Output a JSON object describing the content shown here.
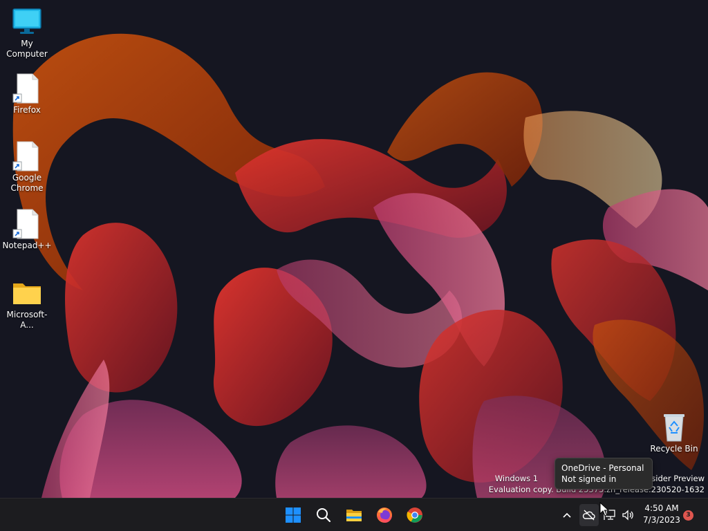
{
  "desktop": {
    "icons": [
      {
        "label": "My Computer"
      },
      {
        "label": "Firefox"
      },
      {
        "label": "Google Chrome"
      },
      {
        "label": "Notepad++"
      },
      {
        "label": "Microsoft-A..."
      },
      {
        "label": "Recycle Bin"
      }
    ],
    "watermark": {
      "line1": "Windows 1                                       n Insider Preview",
      "line2": "Evaluation copy. Build 25375.zn_release.230520-1632"
    }
  },
  "tooltip": {
    "title": "OneDrive - Personal",
    "status": "Not signed in"
  },
  "taskbar": {
    "pinned": [
      {
        "icon": "windows-start-icon"
      },
      {
        "icon": "search-icon"
      },
      {
        "icon": "file-explorer-icon"
      },
      {
        "icon": "firefox-icon"
      },
      {
        "icon": "chrome-icon"
      }
    ],
    "tray": {
      "icons": [
        "chevron-up-icon",
        "onedrive-offline-icon",
        "network-icon",
        "volume-icon"
      ],
      "time": "4:50 AM",
      "date": "7/3/2023",
      "notification_count": "3"
    }
  },
  "colors": {
    "taskbar_bg": "#1c1c1f",
    "desktop_bg": "#151621",
    "badge": "#e0564f",
    "accent_blue": "#1e90ff"
  }
}
